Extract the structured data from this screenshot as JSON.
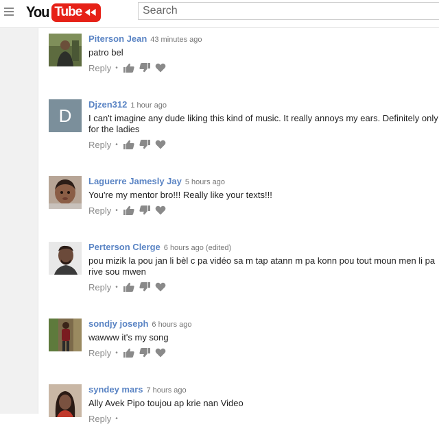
{
  "header": {
    "logo_text": "You",
    "logo_tube": "Tube",
    "search_placeholder": "Search"
  },
  "comments": [
    {
      "author": "Piterson Jean",
      "time": "43 minutes ago",
      "text": "patro bel",
      "reply": "Reply",
      "avatar": "photo-man-outdoors"
    },
    {
      "author": "Djzen312",
      "time": "1 hour ago",
      "text": "I can't imagine any dude liking this kind of music. It really annoys my ears. Definitely only for the ladies",
      "reply": "Reply",
      "avatar_letter": "D"
    },
    {
      "author": "Laguerre Jamesly Jay",
      "time": "5 hours ago",
      "text": "You're my mentor bro!!! Really like your texts!!!",
      "reply": "Reply",
      "avatar": "photo-child"
    },
    {
      "author": "Perterson Clerge",
      "time": "6 hours ago (edited)",
      "text": "pou mizik la pou jan li bèl c pa vidéo sa m tap atann m pa konn pou tout moun men li pa rive sou mwen",
      "reply": "Reply",
      "avatar": "photo-man-portrait"
    },
    {
      "author": "sondjy joseph",
      "time": "6 hours ago",
      "text": "wawww it's my song",
      "reply": "Reply",
      "avatar": "photo-man-standing"
    },
    {
      "author": "syndey mars",
      "time": "7 hours ago",
      "text": "Ally Avek Pipo toujou ap krie nan Video",
      "reply": "Reply",
      "avatar": "photo-woman"
    }
  ],
  "colors": {
    "author": "#5a84c4",
    "brand_red": "#e62117",
    "icon_gray": "#8a8a8a"
  },
  "icons": [
    "menu-icon",
    "play-rewind-icon",
    "thumbs-up-icon",
    "thumbs-down-icon",
    "heart-icon"
  ]
}
